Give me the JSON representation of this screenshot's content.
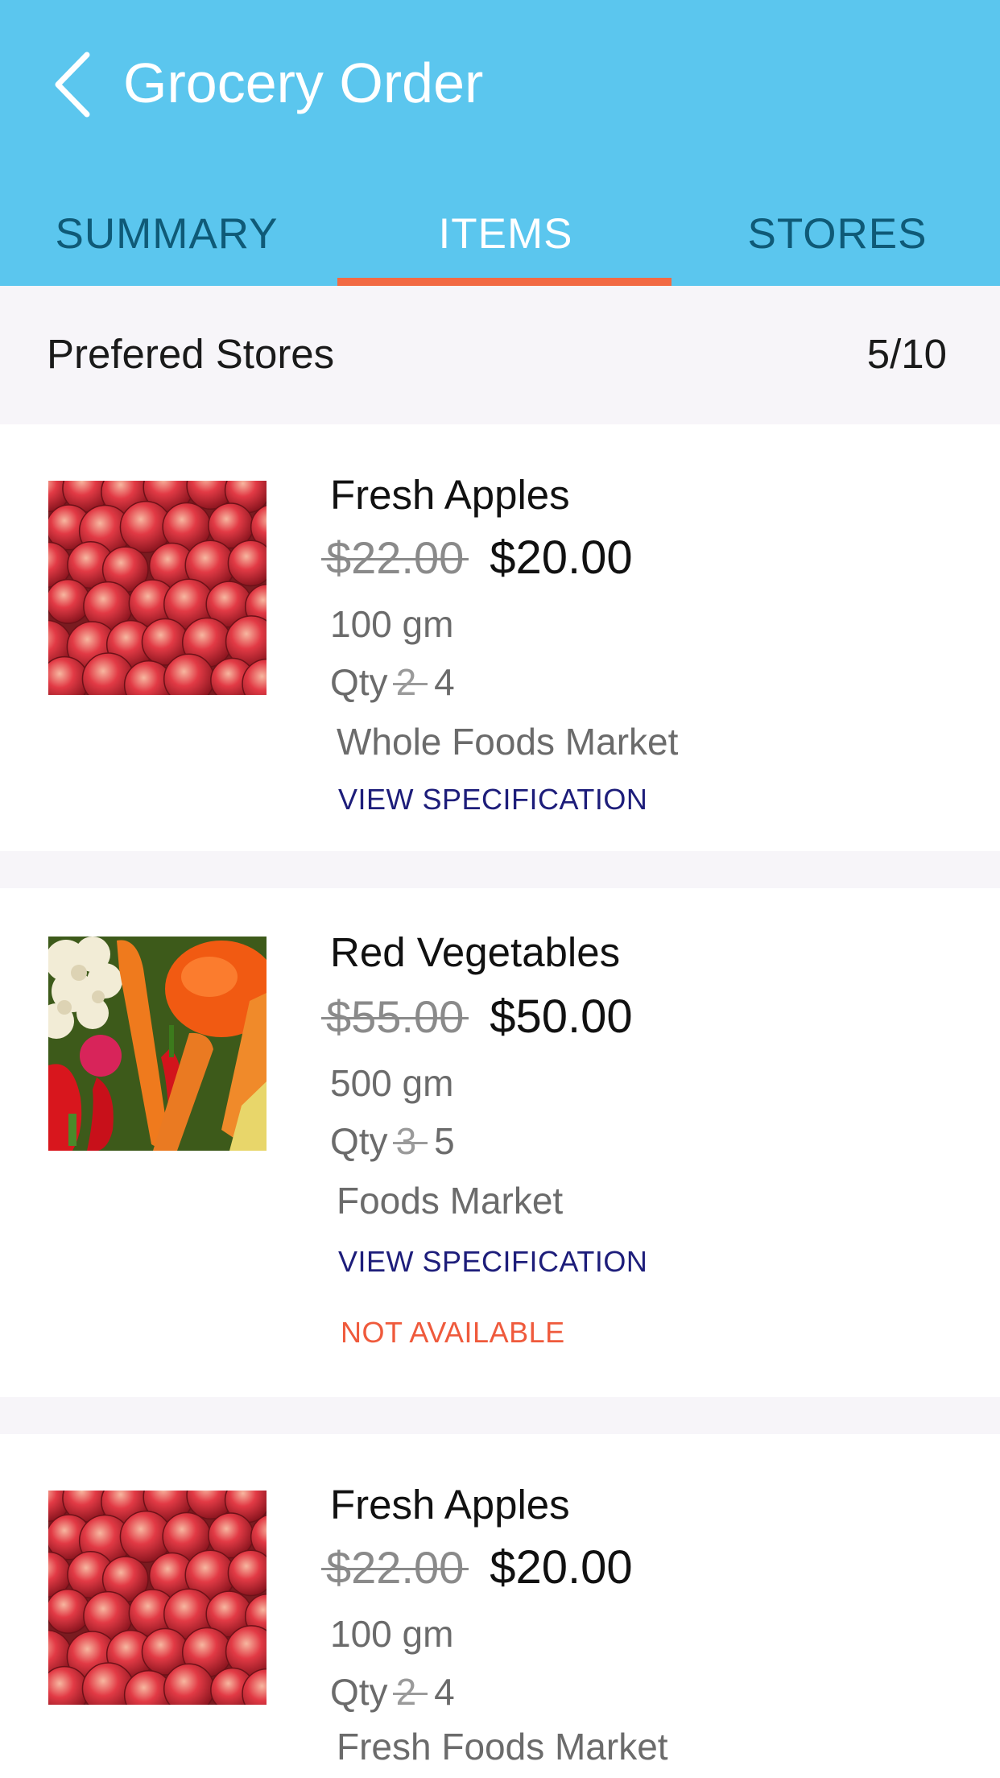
{
  "header": {
    "title": "Grocery Order",
    "back_icon": "chevron-left-icon",
    "background": "#5bc6ee"
  },
  "tabs": [
    {
      "label": "SUMMARY",
      "active": false
    },
    {
      "label": "ITEMS",
      "active": true
    },
    {
      "label": "STORES",
      "active": false
    }
  ],
  "accent_color": "#f26a43",
  "preferred": {
    "label": "Prefered Stores",
    "count": "5/10"
  },
  "items": [
    {
      "name": "Fresh Apples",
      "old_price": "$22.00",
      "price": "$20.00",
      "weight": "100 gm",
      "qty_label": "Qty",
      "qty_old": "2",
      "qty_new": "4",
      "store": "Whole Foods Market",
      "spec_link": "VIEW SPECIFICATION",
      "image": "apples"
    },
    {
      "name": "Red Vegetables",
      "old_price": "$55.00",
      "price": "$50.00",
      "weight": "500 gm",
      "qty_label": "Qty",
      "qty_old": "3",
      "qty_new": "5",
      "store": "Foods Market",
      "spec_link": "VIEW SPECIFICATION",
      "status": "NOT AVAILABLE",
      "image": "vegetables"
    },
    {
      "name": "Fresh Apples",
      "old_price": "$22.00",
      "price": "$20.00",
      "weight": "100 gm",
      "qty_label": "Qty",
      "qty_old": "2",
      "qty_new": "4",
      "store": "Fresh Foods Market",
      "image": "apples"
    }
  ]
}
